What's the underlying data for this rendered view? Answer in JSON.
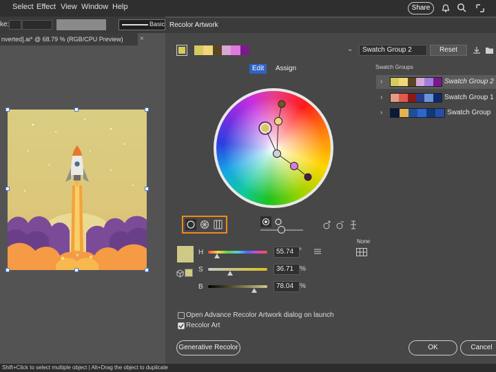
{
  "menubar": {
    "items": [
      "Select",
      "Effect",
      "View",
      "Window",
      "Help"
    ],
    "share_label": "Share"
  },
  "control_bar": {
    "stroke_label": "ke:",
    "brush_label": "Basic"
  },
  "document_tab": {
    "title": "nverted].ai* @ 68.79 % (RGB/CPU Preview)",
    "close": "×"
  },
  "dialog": {
    "title": "Recolor Artwork",
    "color_group_name": "Swatch Group 2",
    "reset_label": "Reset",
    "tabs": [
      {
        "label": "Edit",
        "active": true
      },
      {
        "label": "Assign",
        "active": false
      }
    ],
    "current_palette": [
      "#d6c95f",
      "#f0d77a",
      "#5a4423",
      "#d5a9d1",
      "#e079dd",
      "#7a1a8c"
    ],
    "hsb": {
      "h_label": "H",
      "h_value": "55.74",
      "h_unit": "°",
      "s_label": "S",
      "s_value": "36.71",
      "s_unit": "%",
      "b_label": "B",
      "b_value": "78.04",
      "b_unit": "%",
      "h_level": 0.155,
      "s_level": 0.367,
      "b_level": 0.78
    },
    "base_color": "#cfc987",
    "none_label": "None",
    "advanced_checkbox_label": "Open Advance Recolor Artwork dialog on launch",
    "advanced_checked": false,
    "recolor_art_label": "Recolor Art",
    "recolor_art_checked": true,
    "generative_label": "Generative Recolor",
    "ok_label": "OK",
    "cancel_label": "Cancel"
  },
  "swatch_groups": {
    "header": "Swatch Groups",
    "groups": [
      {
        "name": "Swatch Group 2",
        "selected": true,
        "colors": [
          "#d6c95f",
          "#f0d77a",
          "#5a4423",
          "#d5a9d1",
          "#a07de0",
          "#7a1a8c"
        ]
      },
      {
        "name": "Swatch Group 1",
        "selected": false,
        "colors": [
          "#e39b84",
          "#e05a4b",
          "#8a1a1a",
          "#2b3a8a",
          "#6a93d8",
          "#0d2a6e"
        ]
      },
      {
        "name": "Swatch Group",
        "selected": false,
        "colors": [
          "#0a1a3a",
          "#e2b44b",
          "#1e4f9c",
          "#2d66cf",
          "#0f3a7a",
          "#244ea8"
        ]
      }
    ]
  },
  "status_bar": {
    "hint": "Shift+Click to select multiple object  |  Alt+Drag the object to duplicate"
  },
  "colors": {
    "accent_orange": "#f08a1c",
    "wheel_ring": "#e8e8e8"
  }
}
